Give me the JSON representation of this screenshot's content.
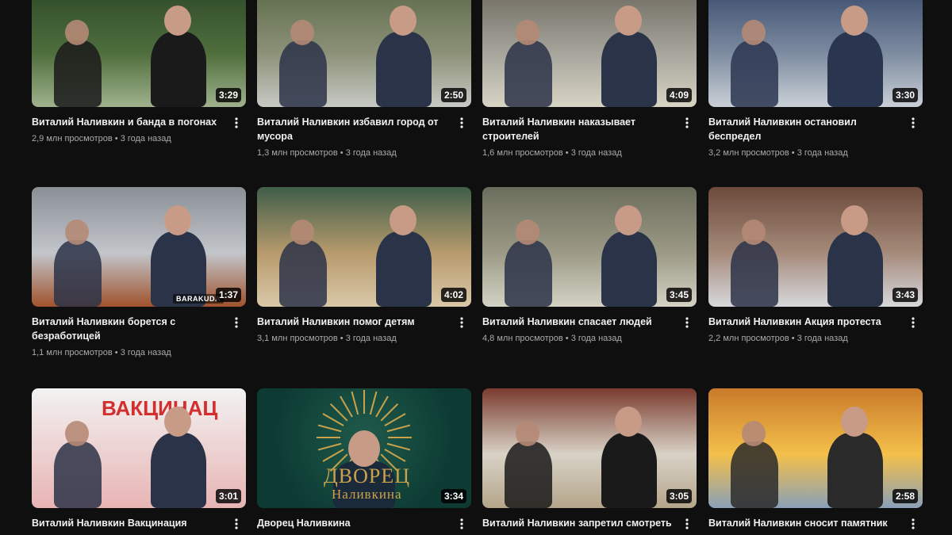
{
  "videos": [
    {
      "title": "Виталий Наливкин и банда в погонах",
      "views": "2,9 млн просмотров",
      "age": "3 года назад",
      "duration": "3:29",
      "palette": [
        "#2e4a2a",
        "#4f6e3c",
        "#9fb18c",
        "#1a1a1a"
      ]
    },
    {
      "title": "Виталий Наливкин избавил город от мусора",
      "views": "1,3 млн просмотров",
      "age": "3 года назад",
      "duration": "2:50",
      "palette": [
        "#5d6b4a",
        "#8c9178",
        "#c7c9c4",
        "#2b3348"
      ]
    },
    {
      "title": "Виталий Наливкин наказывает строителей",
      "views": "1,6 млн просмотров",
      "age": "3 года назад",
      "duration": "4:09",
      "palette": [
        "#6e6a60",
        "#a6a59c",
        "#d8d4c4",
        "#2b3348"
      ]
    },
    {
      "title": "Виталий Наливкин остановил беспредел",
      "views": "3,2 млн просмотров",
      "age": "3 года назад",
      "duration": "3:30",
      "palette": [
        "#3b4d6e",
        "#7d8ba0",
        "#c9cfd6",
        "#2a3550"
      ]
    },
    {
      "title": "Виталий Наливкин борется с безработицей",
      "views": "1,1 млн просмотров",
      "age": "3 года назад",
      "duration": "1:37",
      "palette": [
        "#8a8f96",
        "#c2c6cb",
        "#a0522d",
        "#2b3348"
      ],
      "watermark": "BARAKUDA"
    },
    {
      "title": "Виталий Наливкин помог детям",
      "views": "3,1 млн просмотров",
      "age": "3 года назад",
      "duration": "4:02",
      "palette": [
        "#3f5e4a",
        "#b79a6c",
        "#d9c8a8",
        "#2b3348"
      ]
    },
    {
      "title": "Виталий Наливкин спасает людей",
      "views": "4,8 млн просмотров",
      "age": "3 года назад",
      "duration": "3:45",
      "palette": [
        "#6b6d5c",
        "#9c9a86",
        "#d4d2c4",
        "#2b3348"
      ]
    },
    {
      "title": "Виталий Наливкин Акция протеста",
      "views": "2,2 млн просмотров",
      "age": "3 года назад",
      "duration": "3:43",
      "palette": [
        "#6c4a3c",
        "#a58a7a",
        "#d7d8dc",
        "#2b3348"
      ]
    },
    {
      "title": "Виталий Наливкин Вакцинация",
      "views": "",
      "age": "",
      "duration": "3:01",
      "palette": [
        "#c62828",
        "#f2f2f2",
        "#e8b4b4",
        "#2b3348"
      ],
      "banner": "ВАКЦИНАЦ"
    },
    {
      "title": "Дворец Наливкина",
      "views": "",
      "age": "",
      "duration": "3:34",
      "palette": [
        "#0d3b33",
        "#1f5a4c",
        "#c9a24a",
        "#1b2a3a"
      ],
      "overlay_line1": "ДВОРЕЦ",
      "overlay_line2": "Наливкина"
    },
    {
      "title": "Виталий Наливкин запретил смотреть",
      "views": "",
      "age": "",
      "duration": "3:05",
      "palette": [
        "#7a3b2e",
        "#d8d2c6",
        "#b5a58a",
        "#1a1a1a"
      ]
    },
    {
      "title": "Виталий Наливкин сносит памятник",
      "views": "",
      "age": "",
      "duration": "2:58",
      "palette": [
        "#c97a2a",
        "#f4c04a",
        "#8aa0b8",
        "#2a2a2a"
      ]
    }
  ]
}
